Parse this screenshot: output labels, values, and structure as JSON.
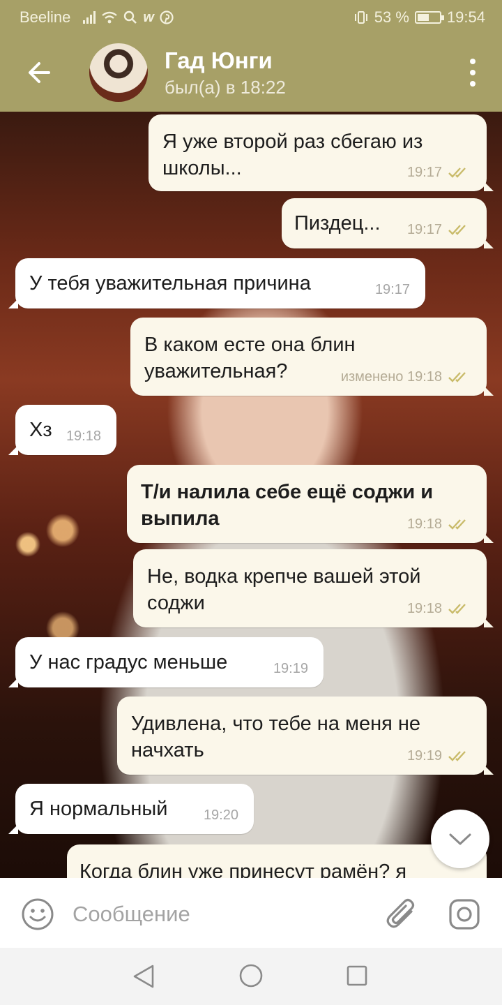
{
  "status_bar": {
    "carrier": "Beeline",
    "battery_text": "53 %",
    "battery_level": 0.53,
    "time": "19:54",
    "icons": [
      "signal-icon",
      "wifi-icon",
      "search-icon",
      "w-app-icon",
      "pinterest-icon",
      "vibrate-icon",
      "battery-icon"
    ]
  },
  "header": {
    "name": "Гад Юнги",
    "status": "был(а) в 18:22"
  },
  "messages": [
    {
      "dir": "out",
      "text": "Я уже второй раз сбегаю из школы...",
      "time": "19:17",
      "read": true
    },
    {
      "dir": "out",
      "text": "Пиздец...",
      "time": "19:17",
      "read": true
    },
    {
      "dir": "in",
      "text": "У тебя уважительная причина",
      "time": "19:17"
    },
    {
      "dir": "out",
      "text": "В каком есте она блин уважительная?",
      "time": "изменено 19:18",
      "read": true
    },
    {
      "dir": "in",
      "text": "Хз",
      "time": "19:18"
    },
    {
      "dir": "out",
      "text": "Т/и налила себе ещё соджи и выпила",
      "time": "19:18",
      "read": true,
      "bold": true
    },
    {
      "dir": "out",
      "text": "Не, водка крепче вашей этой соджи",
      "time": "19:18",
      "read": true
    },
    {
      "dir": "in",
      "text": "У нас градус меньше",
      "time": "19:19"
    },
    {
      "dir": "out",
      "text": "Удивлена, что тебе на меня не начхать",
      "time": "19:19",
      "read": true
    },
    {
      "dir": "in",
      "text": "Я нормальный",
      "time": "19:20"
    },
    {
      "dir": "out",
      "text": "Когда блин уже принесут рамён? я",
      "time": "",
      "read": false
    }
  ],
  "composer": {
    "placeholder": "Сообщение"
  },
  "colors": {
    "header_bg": "#a7a067",
    "outgoing_bubble": "#fbf7ea",
    "incoming_bubble": "#ffffff",
    "read_check": "#c9bb6a"
  }
}
